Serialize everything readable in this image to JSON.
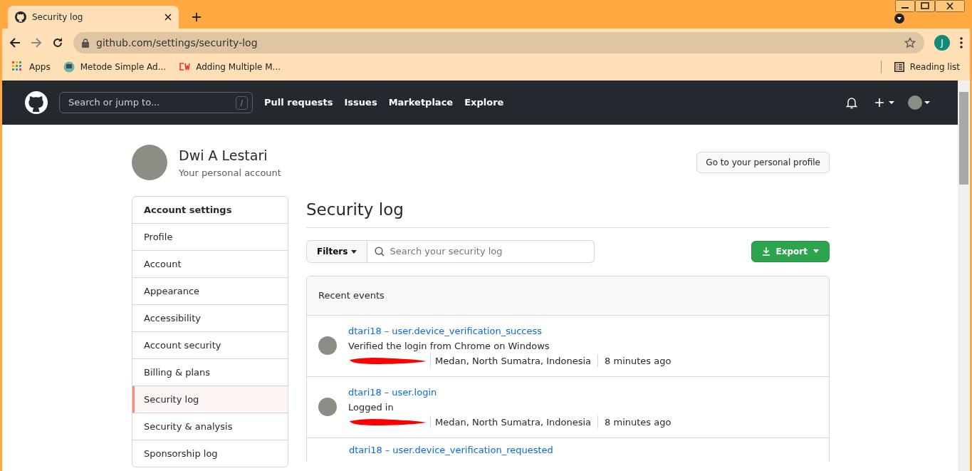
{
  "browser": {
    "tab_title": "Security log",
    "url": "github.com/settings/security-log",
    "profile_initial": "J",
    "bookmarks": [
      "Apps",
      "Metode Simple Ad...",
      "Adding Multiple M..."
    ],
    "reading_list": "Reading list"
  },
  "header": {
    "search_placeholder": "Search or jump to...",
    "slash_key": "/",
    "nav": [
      "Pull requests",
      "Issues",
      "Marketplace",
      "Explore"
    ]
  },
  "account": {
    "name": "Dwi A Lestari",
    "subtitle": "Your personal account",
    "profile_button": "Go to your personal profile"
  },
  "sidebar": {
    "heading": "Account settings",
    "items": [
      {
        "label": "Profile",
        "selected": false
      },
      {
        "label": "Account",
        "selected": false
      },
      {
        "label": "Appearance",
        "selected": false
      },
      {
        "label": "Accessibility",
        "selected": false
      },
      {
        "label": "Account security",
        "selected": false
      },
      {
        "label": "Billing & plans",
        "selected": false
      },
      {
        "label": "Security log",
        "selected": true
      },
      {
        "label": "Security & analysis",
        "selected": false
      },
      {
        "label": "Sponsorship log",
        "selected": false
      }
    ]
  },
  "main": {
    "title": "Security log",
    "filters_button": "Filters",
    "search_placeholder": "Search your security log",
    "export_button": "Export",
    "events_heading": "Recent events",
    "events": [
      {
        "user": "dtari18",
        "separator": "–",
        "action": "user.device_verification_success",
        "description": "Verified the login from Chrome on Windows",
        "location": "Medan, North Sumatra, Indonesia",
        "time": "8 minutes ago"
      },
      {
        "user": "dtari18",
        "separator": "–",
        "action": "user.login",
        "description": "Logged in",
        "location": "Medan, North Sumatra, Indonesia",
        "time": "8 minutes ago"
      },
      {
        "user": "dtari18",
        "separator": "–",
        "action": "user.device_verification_requested"
      }
    ]
  }
}
